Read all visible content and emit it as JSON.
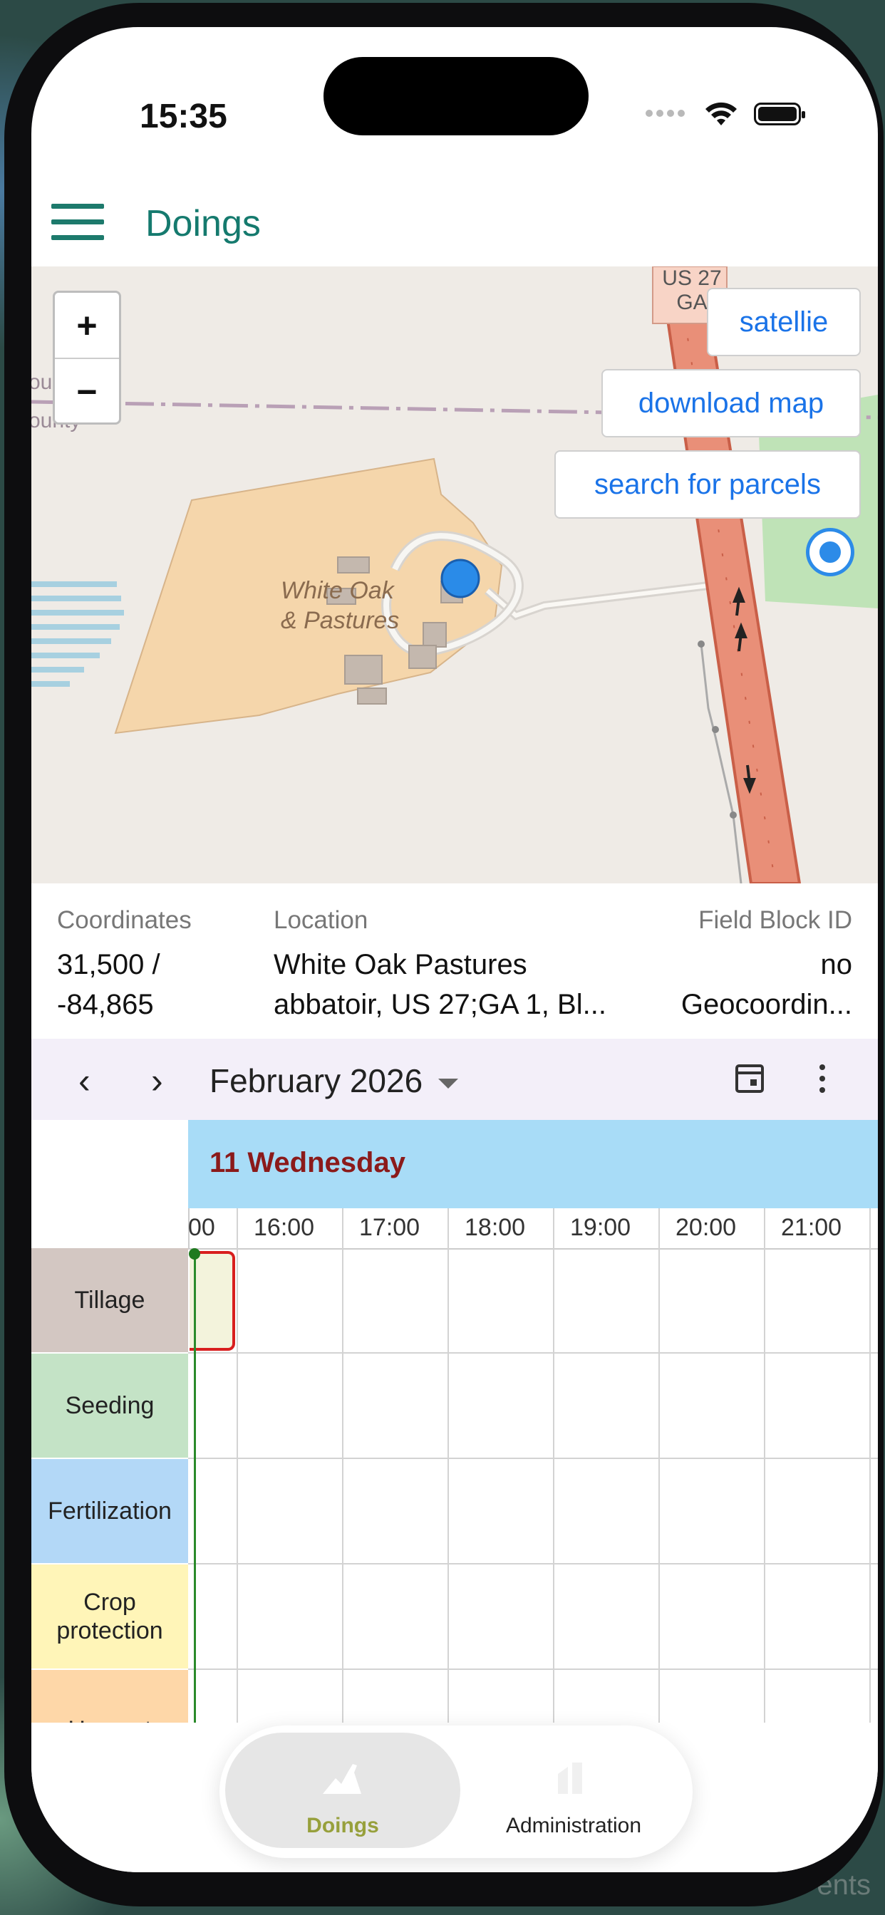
{
  "status": {
    "time": "15:35"
  },
  "app": {
    "title": "Doings"
  },
  "map": {
    "zoom_in": "+",
    "zoom_out": "−",
    "buttons": {
      "satellite": "satellie",
      "download": "download map",
      "search": "search for parcels"
    },
    "labels": {
      "road_line1": "US 27",
      "road_line2": "GA",
      "area_line1": "White Oak",
      "area_line2": "& Pastures",
      "county_top": "our",
      "county_bottom": "ounty"
    }
  },
  "info": {
    "coordinates": {
      "label": "Coordinates",
      "line1": "31,500 /",
      "line2": "-84,865"
    },
    "location": {
      "label": "Location",
      "line1": "White Oak Pastures",
      "line2": "abbatoir, US 27;GA 1, Bl..."
    },
    "field_block": {
      "label": "Field Block ID",
      "line1": "no",
      "line2": "Geocoordin..."
    }
  },
  "calendar": {
    "prev": "‹",
    "next": "›",
    "month": "February 2026",
    "day_header": "11 Wednesday",
    "hours": [
      "00",
      "16:00",
      "17:00",
      "18:00",
      "19:00",
      "20:00",
      "21:00"
    ],
    "rows": [
      {
        "label": "Tillage",
        "color": "#d3c7c2"
      },
      {
        "label": "Seeding",
        "color": "#c4e3c6"
      },
      {
        "label": "Fertilization",
        "color": "#b3d8f7"
      },
      {
        "label_line1": "Crop",
        "label_line2": "protection",
        "color": "#fff5b8"
      },
      {
        "label": "Harvest",
        "color": "#fed7a8"
      }
    ]
  },
  "tabs": {
    "doings": "Doings",
    "administration": "Administration"
  },
  "background_text": "ents",
  "colors": {
    "accent": "#157a6e",
    "link": "#1a73e8",
    "day_header_bg": "#a8dcf7",
    "day_header_text": "#8b1a1a",
    "active_tab": "#97a03c"
  }
}
